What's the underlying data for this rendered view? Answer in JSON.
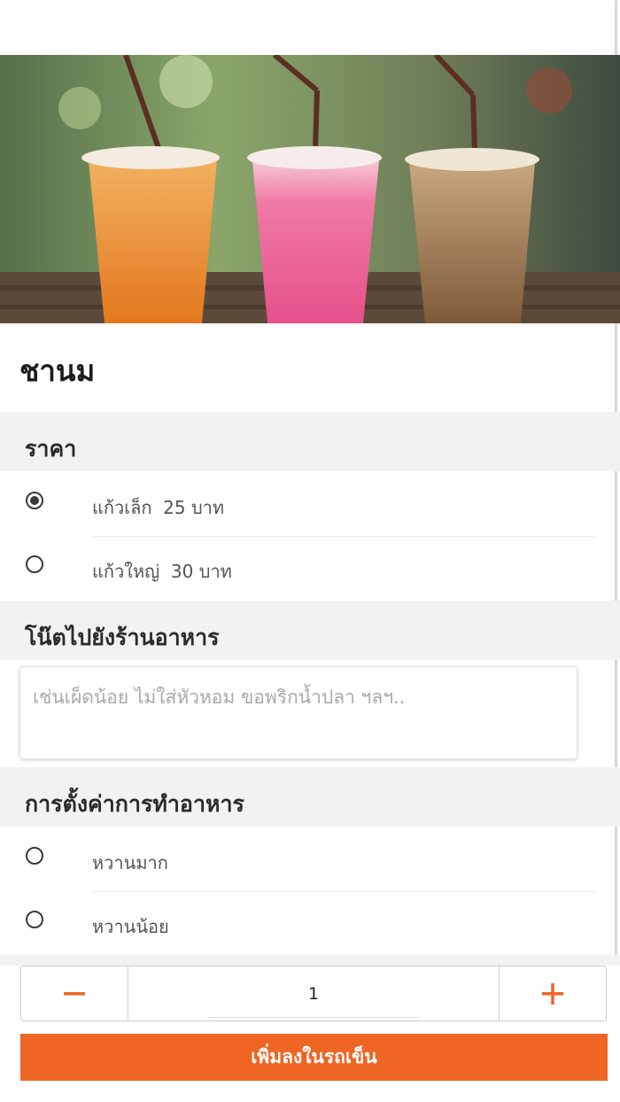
{
  "product": {
    "image_alt": "iced drinks",
    "title": "ชานม"
  },
  "price_section": {
    "header": "ราคา",
    "options": [
      {
        "label": "แก้วเล็ก  25 บาท",
        "selected": true
      },
      {
        "label": "แก้วใหญ่  30 บาท",
        "selected": false
      }
    ]
  },
  "note_section": {
    "header": "โน๊ตไปยังร้านอาหาร",
    "placeholder": "เช่นเผ็ดน้อย ไม่ใส่หัวหอม ขอพริกน้ำปลา ฯลฯ..",
    "value": ""
  },
  "cooking_section": {
    "header": "การตั้งค่าการทำอาหาร",
    "options": [
      {
        "label": "หวานมาก",
        "selected": false
      },
      {
        "label": "หวานน้อย",
        "selected": false
      }
    ]
  },
  "quantity": {
    "value": "1",
    "minus_icon": "minus-icon",
    "plus_icon": "plus-icon"
  },
  "add_to_cart": {
    "label": "เพิ่มลงในรถเข็น"
  },
  "colors": {
    "accent": "#ef6524",
    "section_bg": "#f2f2f2"
  }
}
